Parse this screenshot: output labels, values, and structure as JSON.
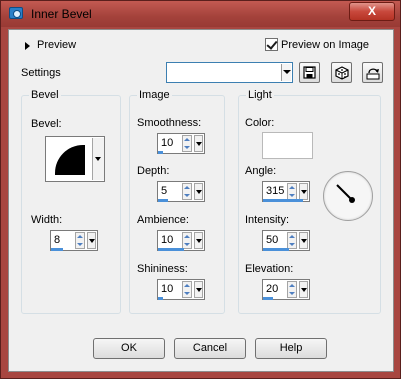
{
  "window": {
    "title": "Inner Bevel",
    "close_label": "X"
  },
  "preview": {
    "toggle_label": "Preview",
    "checkbox_label": "Preview on Image",
    "checked": true
  },
  "settings": {
    "label": "Settings",
    "value": ""
  },
  "toolbar": {
    "icons": [
      "save-preset-icon",
      "randomize-icon",
      "reset-icon"
    ]
  },
  "bevel_group": {
    "title": "Bevel",
    "bevel_label": "Bevel:",
    "width_label": "Width:",
    "width_value": "8"
  },
  "image_group": {
    "title": "Image",
    "smoothness_label": "Smoothness:",
    "smoothness_value": "10",
    "depth_label": "Depth:",
    "depth_value": "5",
    "ambience_label": "Ambience:",
    "ambience_value": "10",
    "shininess_label": "Shininess:",
    "shininess_value": "10"
  },
  "light_group": {
    "title": "Light",
    "color_label": "Color:",
    "color_value": "#ffffff",
    "angle_label": "Angle:",
    "angle_value": "315",
    "intensity_label": "Intensity:",
    "intensity_value": "50",
    "elevation_label": "Elevation:",
    "elevation_value": "20"
  },
  "buttons": {
    "ok": "OK",
    "cancel": "Cancel",
    "help": "Help"
  },
  "colors": {
    "titlebar": "#a84640",
    "close": "#c8483c",
    "accent": "#4a90d9",
    "dialog_bg": "#f0f0f0"
  }
}
